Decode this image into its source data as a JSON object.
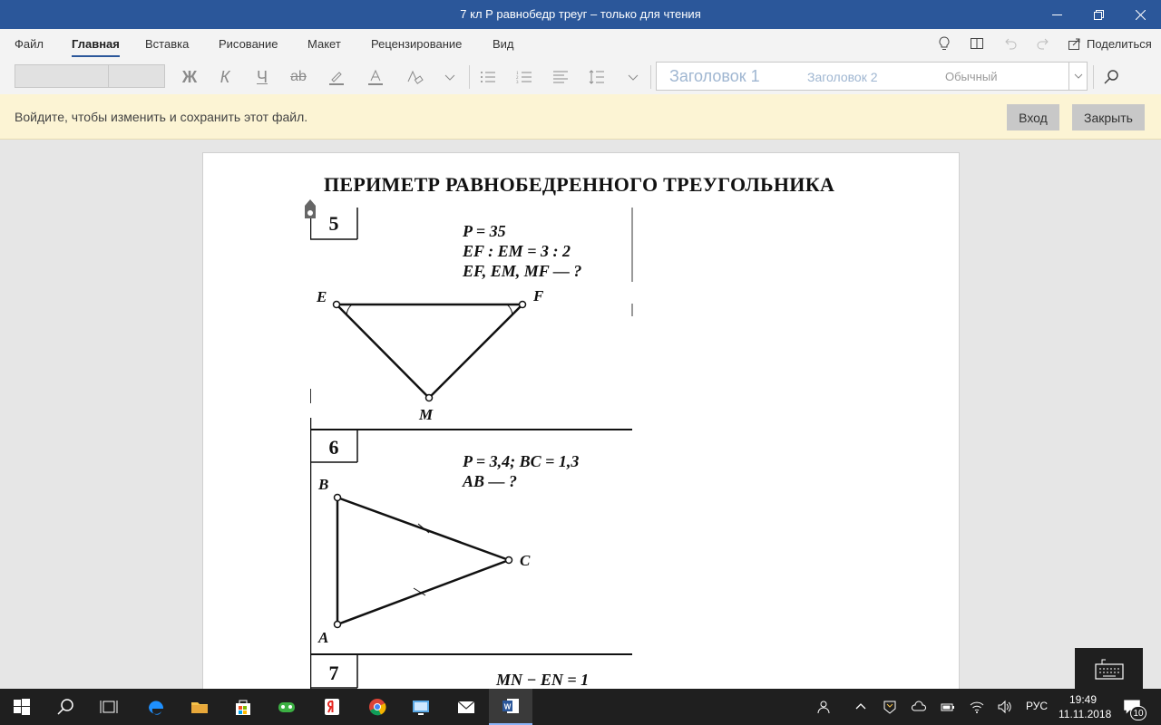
{
  "window": {
    "title": "7 кл Р равнобедр треуг – только для чтения"
  },
  "ribbon": {
    "tabs": [
      {
        "label": "Файл"
      },
      {
        "label": "Главная",
        "active": true
      },
      {
        "label": "Вставка"
      },
      {
        "label": "Рисование"
      },
      {
        "label": "Макет"
      },
      {
        "label": "Рецензирование"
      },
      {
        "label": "Вид"
      }
    ],
    "share_label": "Поделиться",
    "formatting": {
      "bold": "Ж",
      "italic": "К",
      "underline": "Ч",
      "strike": "ab"
    },
    "styles": {
      "heading1": "Заголовок 1",
      "heading2": "Заголовок 2",
      "normal": "Обычный"
    }
  },
  "infobar": {
    "message": "Войдите, чтобы изменить и сохранить этот файл.",
    "signin_label": "Вход",
    "close_label": "Закрыть"
  },
  "document": {
    "title": "ПЕРИМЕТР РАВНОБЕДРЕННОГО ТРЕУГОЛЬНИКА",
    "problems": [
      {
        "number": "5",
        "lines": [
          "P = 35",
          "EF : EM = 3 : 2",
          "EF, EM, MF — ?"
        ],
        "vertices": [
          "E",
          "F",
          "M"
        ]
      },
      {
        "number": "6",
        "lines": [
          "P = 3,4; BC = 1,3",
          "AB — ?"
        ],
        "vertices": [
          "B",
          "C",
          "A"
        ]
      },
      {
        "number": "7",
        "lines": [
          "MN − EN = 1"
        ]
      }
    ]
  },
  "taskbar": {
    "language": "РУС",
    "time": "19:49",
    "date": "11.11.2018",
    "notifications": "10"
  },
  "colors": {
    "titlebar": "#2b579a",
    "ribbon_bg": "#f3f3f3",
    "infobar_bg": "#fcf4d4",
    "taskbar_bg": "#1f1f1f"
  }
}
